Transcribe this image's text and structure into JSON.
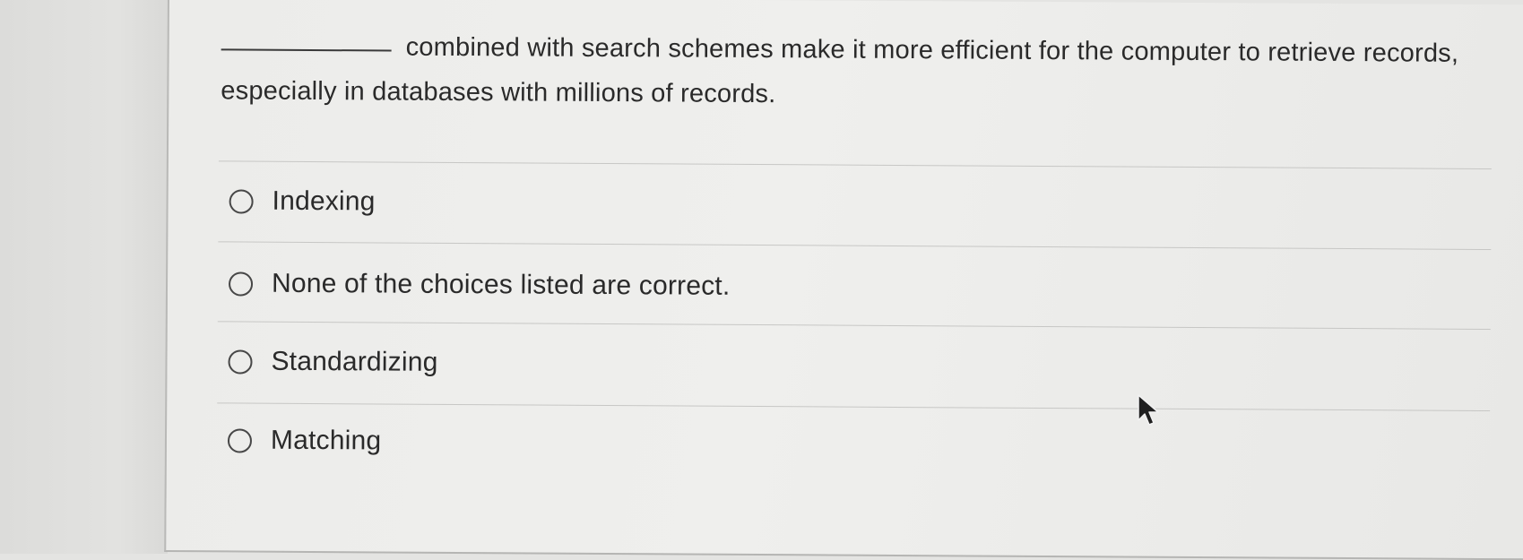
{
  "question": {
    "text": "combined with search schemes make it more efficient for the computer to retrieve records, especially in databases with millions of records."
  },
  "options": [
    {
      "label": "Indexing",
      "selected": false
    },
    {
      "label": "None of the choices listed are correct.",
      "selected": false
    },
    {
      "label": "Standardizing",
      "selected": false
    },
    {
      "label": "Matching",
      "selected": false
    }
  ],
  "icons": {
    "radio": "radio-circle-icon",
    "cursor": "mouse-pointer-icon"
  },
  "colors": {
    "text": "#2a2a2a",
    "background": "#ececea",
    "divider": "#c7c7c5"
  }
}
